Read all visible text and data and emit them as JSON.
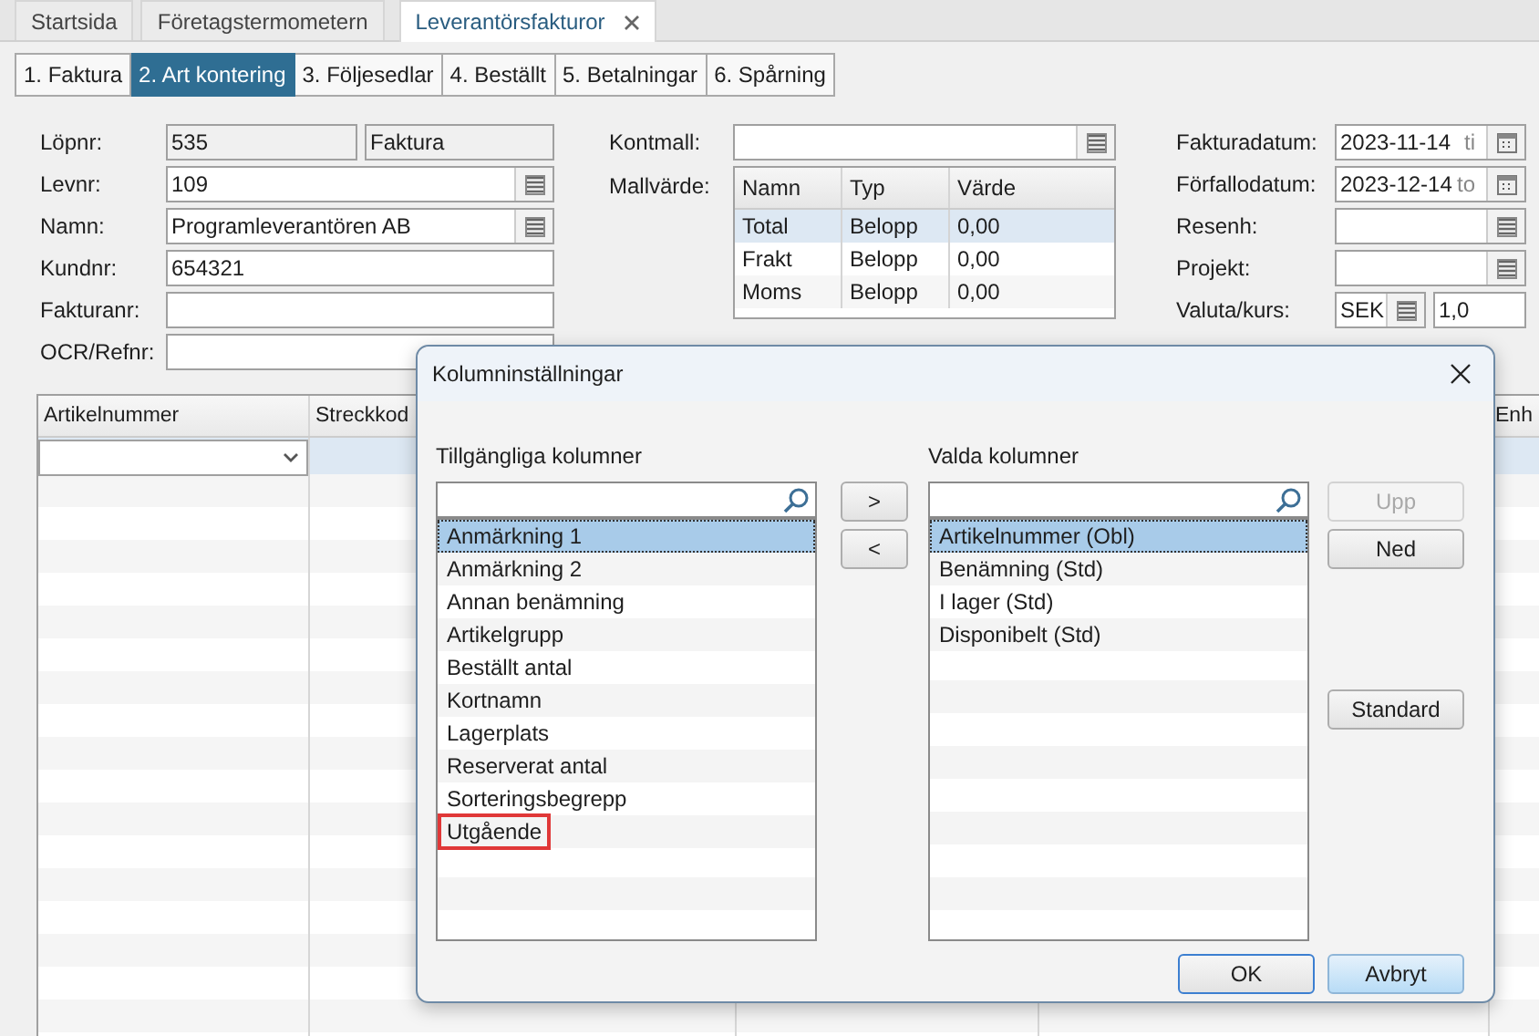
{
  "app_tabs": [
    {
      "label": "Startsida",
      "selected": false,
      "closable": false
    },
    {
      "label": "Företagstermometern",
      "selected": false,
      "closable": false
    },
    {
      "label": "Leverantörsfakturor",
      "selected": true,
      "closable": true
    }
  ],
  "sub_tabs": [
    {
      "label": "1. Faktura",
      "selected": false
    },
    {
      "label": "2. Art kontering",
      "selected": true
    },
    {
      "label": "3. Följesedlar",
      "selected": false
    },
    {
      "label": "4. Beställt",
      "selected": false
    },
    {
      "label": "5. Betalningar",
      "selected": false
    },
    {
      "label": "6. Spårning",
      "selected": false
    }
  ],
  "form_left": [
    {
      "label": "Löpnr:",
      "kind": "split",
      "value": "535",
      "value_2": "Faktura"
    },
    {
      "label": "Levnr:",
      "kind": "lookup",
      "value": "109"
    },
    {
      "label": "Namn:",
      "kind": "lookup",
      "value": "Programleverantören AB"
    },
    {
      "label": "Kundnr:",
      "kind": "text",
      "value": "654321"
    },
    {
      "label": "Fakturanr:",
      "kind": "text"
    },
    {
      "label": "OCR/Refnr:",
      "kind": "text"
    }
  ],
  "kontmall": {
    "label": "Kontmall:"
  },
  "mallvarde": {
    "label": "Mallvärde:",
    "columns": [
      "Namn",
      "Typ",
      "Värde"
    ],
    "rows": [
      {
        "cells": [
          "Total",
          "Belopp",
          "0,00"
        ],
        "selected": true
      },
      {
        "cells": [
          "Frakt",
          "Belopp",
          "0,00"
        ],
        "selected": false
      },
      {
        "cells": [
          "Moms",
          "Belopp",
          "0,00"
        ],
        "selected": false
      }
    ]
  },
  "form_right": [
    {
      "label": "Fakturadatum:",
      "kind": "date",
      "value": "2023-11-14",
      "weekday": "ti"
    },
    {
      "label": "Förfallodatum:",
      "kind": "date",
      "value": "2023-12-14",
      "weekday": "to"
    },
    {
      "label": "Resenh:",
      "kind": "lookup"
    },
    {
      "label": "Projekt:",
      "kind": "lookup"
    },
    {
      "label": "Valuta/kurs:",
      "kind": "currency",
      "value": "SEK",
      "value_2": "1,0"
    }
  ],
  "grid": {
    "columns": [
      "Artikelnummer",
      "Streckkod",
      "Enh"
    ]
  },
  "dialog": {
    "title": "Kolumninställningar",
    "available": {
      "label": "Tillgängliga kolumner",
      "items": [
        {
          "text": "Anmärkning 1",
          "selected": true,
          "marked": false
        },
        {
          "text": "Anmärkning 2",
          "selected": false,
          "marked": false
        },
        {
          "text": "Annan benämning",
          "selected": false,
          "marked": false
        },
        {
          "text": "Artikelgrupp",
          "selected": false,
          "marked": false
        },
        {
          "text": "Beställt antal",
          "selected": false,
          "marked": false
        },
        {
          "text": "Kortnamn",
          "selected": false,
          "marked": false
        },
        {
          "text": "Lagerplats",
          "selected": false,
          "marked": false
        },
        {
          "text": "Reserverat antal",
          "selected": false,
          "marked": false
        },
        {
          "text": "Sorteringsbegrepp",
          "selected": false,
          "marked": false
        },
        {
          "text": "Utgående",
          "selected": false,
          "marked": true
        }
      ]
    },
    "move_buttons": [
      ">",
      "<"
    ],
    "chosen": {
      "label": "Valda kolumner",
      "items": [
        {
          "text": "Artikelnummer (Obl)",
          "selected": true,
          "marked": false
        },
        {
          "text": "Benämning (Std)",
          "selected": false,
          "marked": false
        },
        {
          "text": "I lager (Std)",
          "selected": false,
          "marked": false
        },
        {
          "text": "Disponibelt (Std)",
          "selected": false,
          "marked": false
        }
      ]
    },
    "order_buttons": [
      {
        "label": "Upp",
        "disabled": true
      },
      {
        "label": "Ned",
        "disabled": false
      }
    ],
    "reset_button": {
      "label": "Standard",
      "disabled": false
    },
    "footer_buttons": [
      {
        "label": "OK",
        "default": true,
        "hovered": false
      },
      {
        "label": "Avbryt",
        "default": false,
        "hovered": true
      }
    ]
  }
}
